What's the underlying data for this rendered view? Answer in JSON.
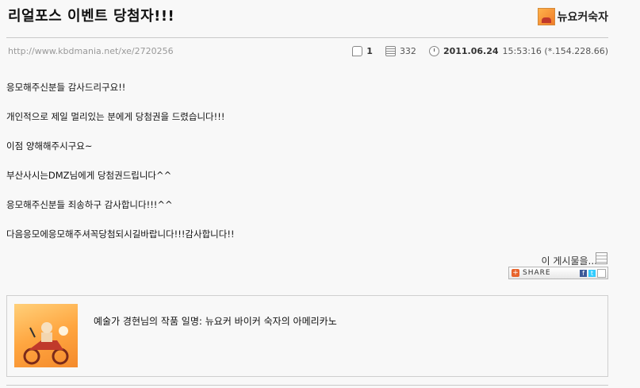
{
  "post": {
    "title": "리얼포스 이벤트 당첨자!!!",
    "author": "뉴요커숙자",
    "url": "http://www.kbdmania.net/xe/2720256",
    "comments": "1",
    "views": "332",
    "date": "2011.06.24",
    "time": "15:53:16 (*.154.228.66)"
  },
  "body": {
    "lines": [
      "응모해주신분들 감사드리구요!!",
      "개인적으로 제일 멀리있는 분에게 당첨권을 드렸습니다!!!",
      "이점 양해해주시구요~",
      "부산사시는DMZ님에게 당첨권드립니다^^",
      "응모해주신분들 죄송하구 감사합니다!!!^^",
      "다음응모에응모해주셔꼭당첨되시길바랍니다!!!감사합니다!!"
    ]
  },
  "share": {
    "label": "이 게시물을...",
    "button": "SHARE",
    "fb": "f",
    "tw": "t"
  },
  "signature": {
    "text": "예술가 경현님의 작품 일명: 뉴요커 바이커 숙자의 아메리카노"
  }
}
